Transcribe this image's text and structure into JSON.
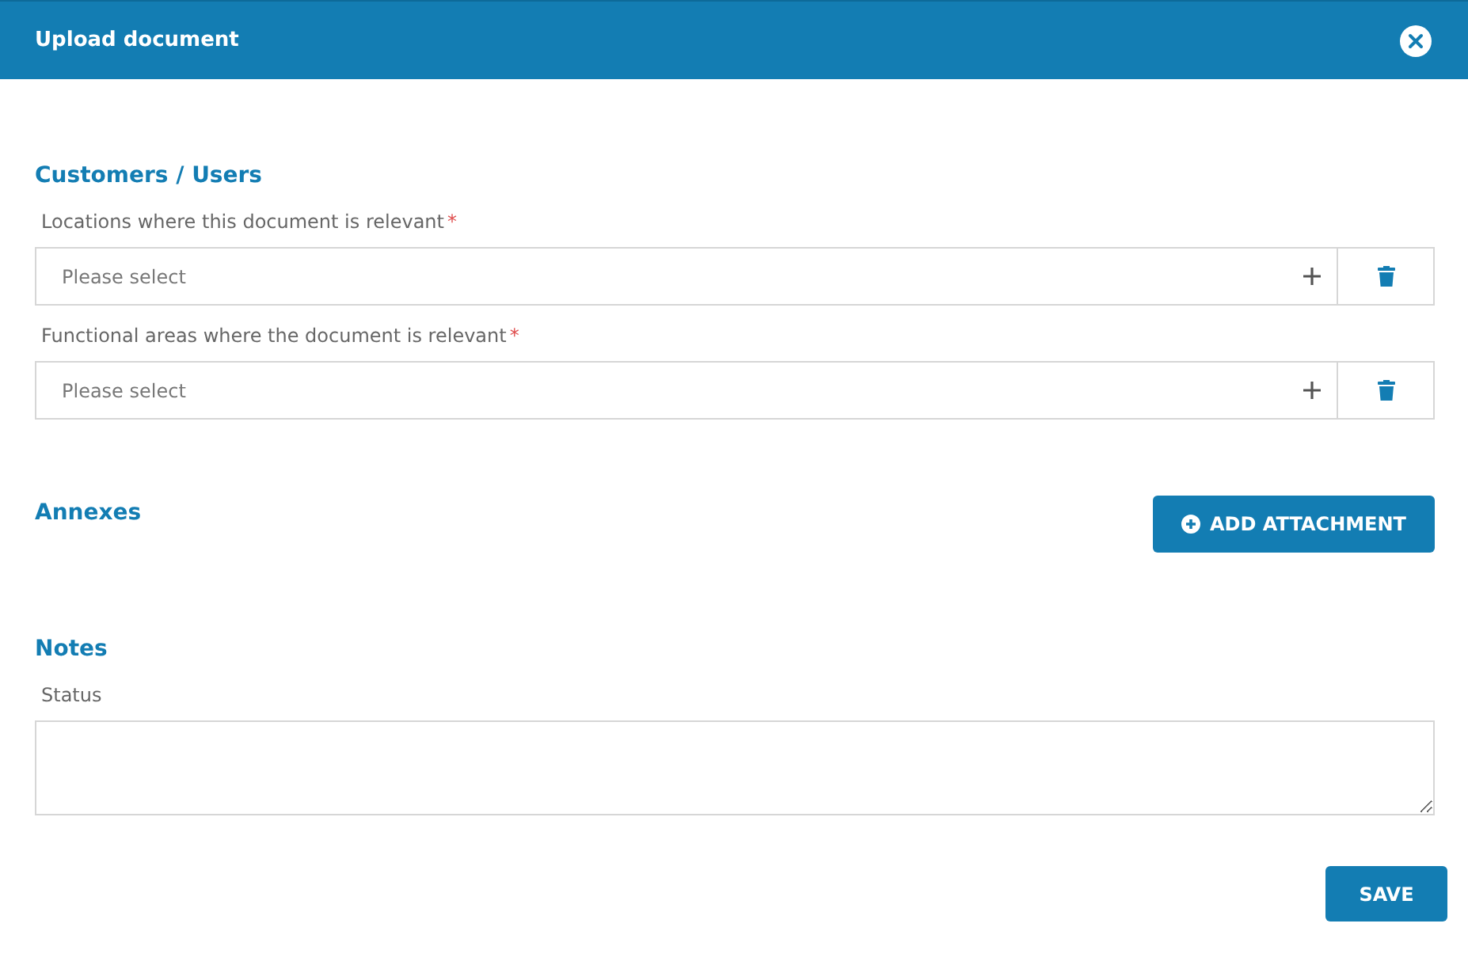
{
  "window": {
    "title": "Upload document"
  },
  "sections": [
    {
      "kind": "selects",
      "title": "Customers / Users",
      "fields": [
        {
          "label": "Locations where this document is relevant",
          "required_mark": "*",
          "placeholder": "Please select"
        },
        {
          "label": "Functional areas where the document is relevant",
          "required_mark": "*",
          "placeholder": "Please select"
        }
      ]
    },
    {
      "kind": "attachments",
      "title": "Annexes",
      "button": "ADD ATTACHMENT"
    },
    {
      "kind": "notes",
      "title": "Notes",
      "label": "Status"
    }
  ],
  "buttons": [
    "SAVE"
  ]
}
